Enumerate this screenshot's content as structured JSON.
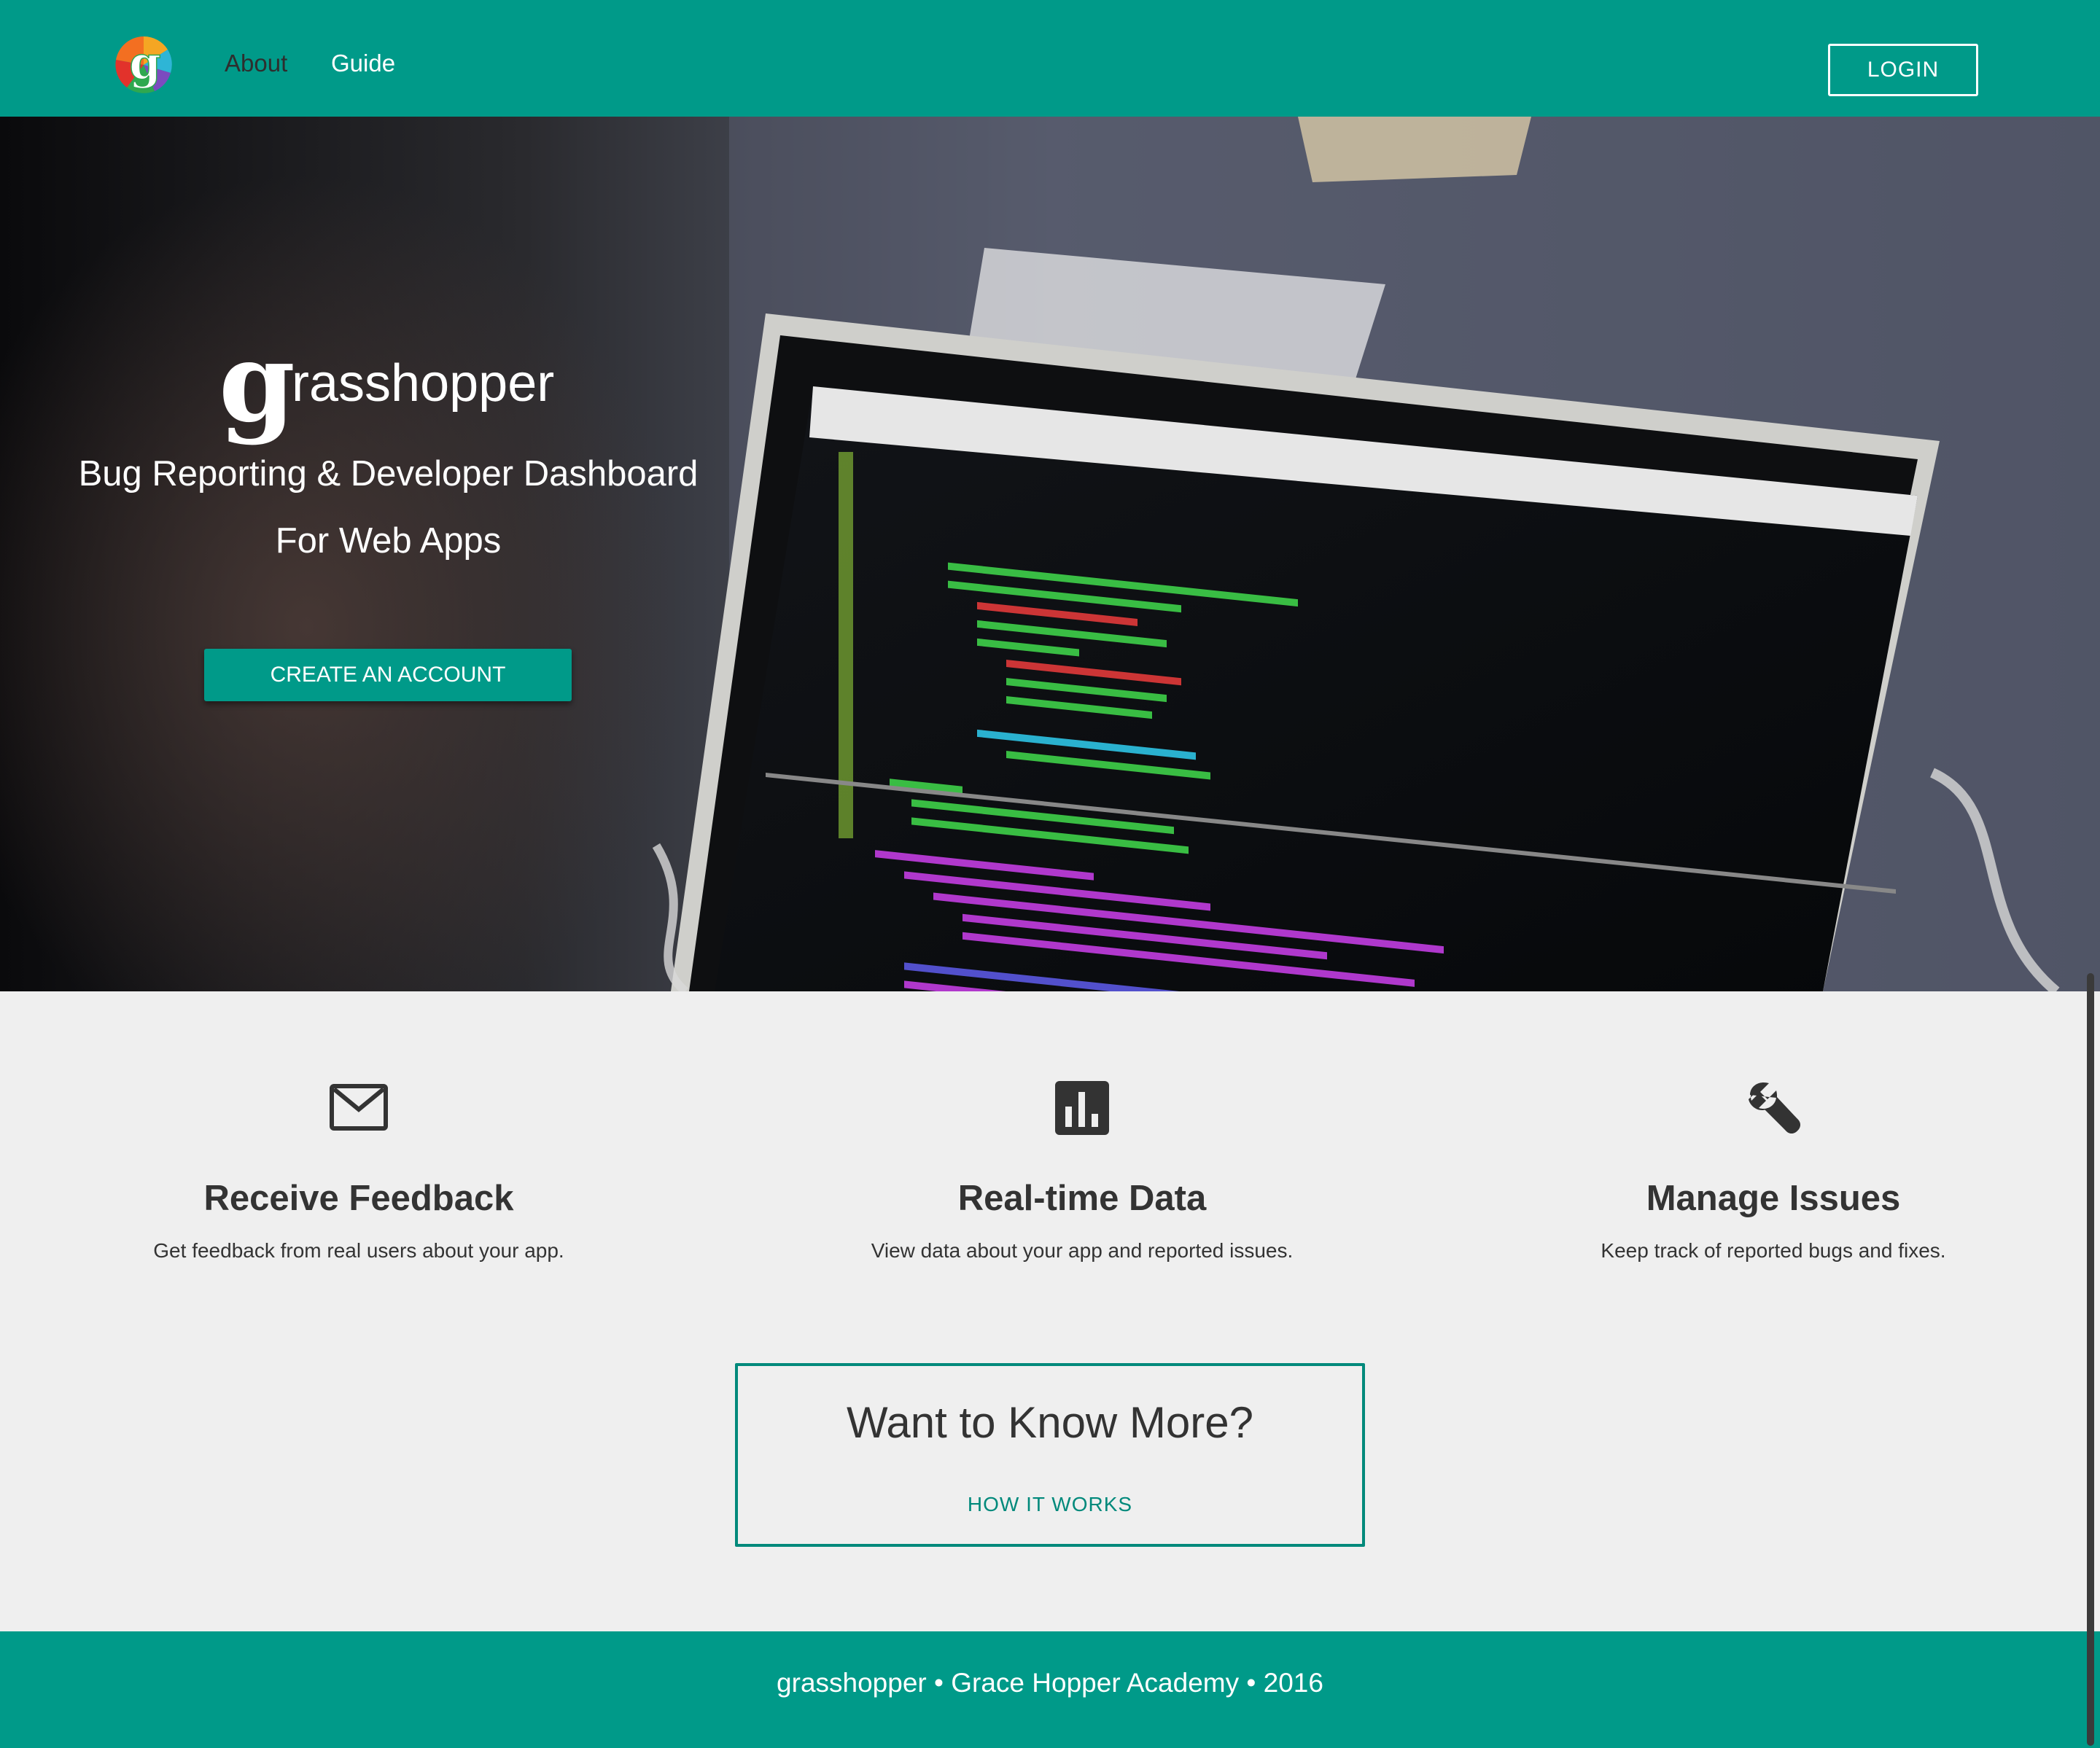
{
  "navbar": {
    "logo_letter": "g",
    "links": [
      {
        "label": "About"
      },
      {
        "label": "Guide"
      }
    ],
    "login_label": "LOGIN"
  },
  "hero": {
    "brand_initial": "g",
    "brand_rest": "rasshopper",
    "tagline_line1": "Bug Reporting & Developer Dashboard",
    "tagline_line2": "For Web Apps",
    "cta_label": "CREATE AN ACCOUNT"
  },
  "features": [
    {
      "icon": "mail-icon",
      "title": "Receive Feedback",
      "description": "Get feedback from real users about your app."
    },
    {
      "icon": "bar-chart-icon",
      "title": "Real-time Data",
      "description": "View data about your app and reported issues."
    },
    {
      "icon": "wrench-icon",
      "title": "Manage Issues",
      "description": "Keep track of reported bugs and fixes."
    }
  ],
  "cta": {
    "title": "Want to Know More?",
    "link_label": "HOW IT WORKS"
  },
  "footer": {
    "text": "grasshopper • Grace Hopper Academy • 2016"
  },
  "colors": {
    "primary": "#009a89",
    "accent": "#00897b",
    "background": "#efefef",
    "text": "#333333"
  }
}
